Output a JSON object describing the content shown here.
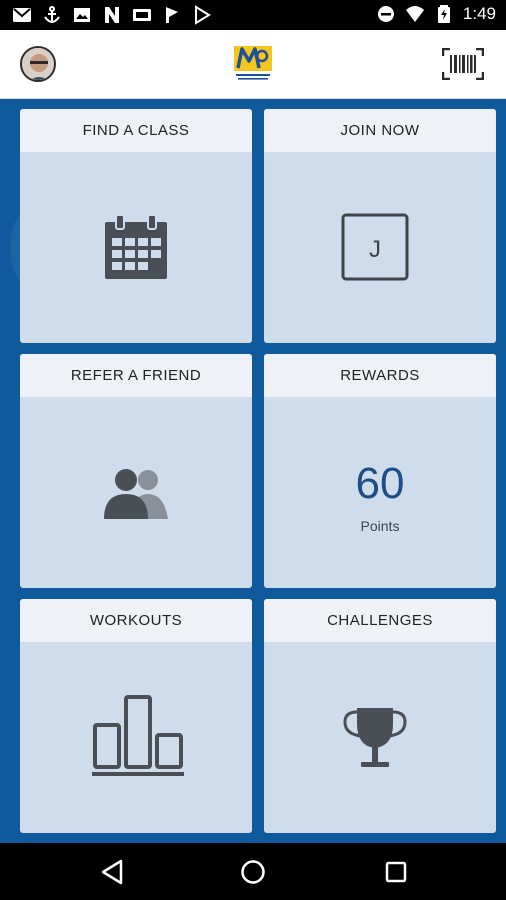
{
  "status_bar": {
    "time": "1:49",
    "left_icons": [
      "gmail-icon",
      "anchor-icon",
      "photo-icon",
      "news-icon",
      "cast-icon",
      "flag-icon",
      "play-store-icon"
    ],
    "right_icons": [
      "do-not-disturb-icon",
      "wifi-icon",
      "battery-icon"
    ]
  },
  "header": {
    "logo_icon": "gym-logo-icon",
    "scan_icon": "barcode-scan-icon",
    "avatar_icon": "user-avatar"
  },
  "tiles": [
    {
      "label": "FIND A CLASS",
      "icon": "calendar-icon"
    },
    {
      "label": "JOIN NOW",
      "icon": "join-card-icon",
      "letter": "J"
    },
    {
      "label": "REFER A FRIEND",
      "icon": "people-icon"
    },
    {
      "label": "REWARDS",
      "points": "60",
      "points_label": "Points"
    },
    {
      "label": "WORKOUTS",
      "icon": "bar-chart-icon"
    },
    {
      "label": "CHALLENGES",
      "icon": "trophy-icon"
    }
  ],
  "nav_bar": {
    "buttons": [
      "back",
      "home",
      "recents"
    ]
  },
  "colors": {
    "background": "#0f5b9e",
    "tile": "#cfdceb",
    "tile_header": "#eef1f5",
    "icon": "#4a4f55",
    "points": "#1e4e86"
  }
}
